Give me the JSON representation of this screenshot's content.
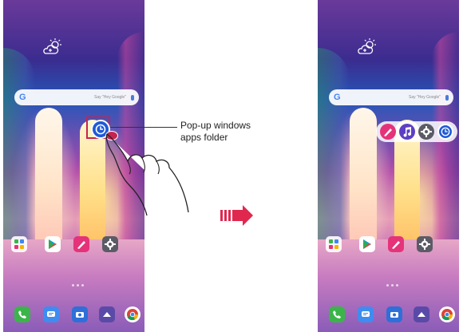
{
  "annotation": {
    "callout_text_line1": "Pop-up windows",
    "callout_text_line2": "apps folder"
  },
  "screens": {
    "left": {
      "search_logo": "G",
      "search_hint": "Say \"Hey Google\"",
      "weather_icon": "weather-cloud-sun-icon",
      "home_apps": [
        "apps-folder-icon",
        "play-store-icon",
        "pen-icon",
        "settings-icon"
      ],
      "dock_apps": [
        "phone-icon",
        "messages-icon",
        "camera-icon",
        "app-drawer-icon",
        "chrome-icon"
      ],
      "popup_folder_icon": "clock-icon"
    },
    "right": {
      "search_logo": "G",
      "search_hint": "Say \"Hey Google\"",
      "weather_icon": "weather-cloud-sun-icon",
      "popup_apps": [
        "pen-icon",
        "music-icon",
        "settings-icon",
        "clock-icon"
      ],
      "home_apps": [
        "apps-folder-icon",
        "play-store-icon",
        "pen-icon",
        "settings-icon"
      ],
      "dock_apps": [
        "phone-icon",
        "messages-icon",
        "camera-icon",
        "app-drawer-icon",
        "chrome-icon"
      ]
    }
  },
  "colors": {
    "highlight": "#c6244f",
    "clock_blue": "#1f5ad8",
    "music_purple": "#5d3fc4",
    "pen_pink": "#e5337a",
    "settings_gray": "#5b5b66",
    "phone_green": "#3bb54a",
    "arrow_red": "#e0284f"
  }
}
